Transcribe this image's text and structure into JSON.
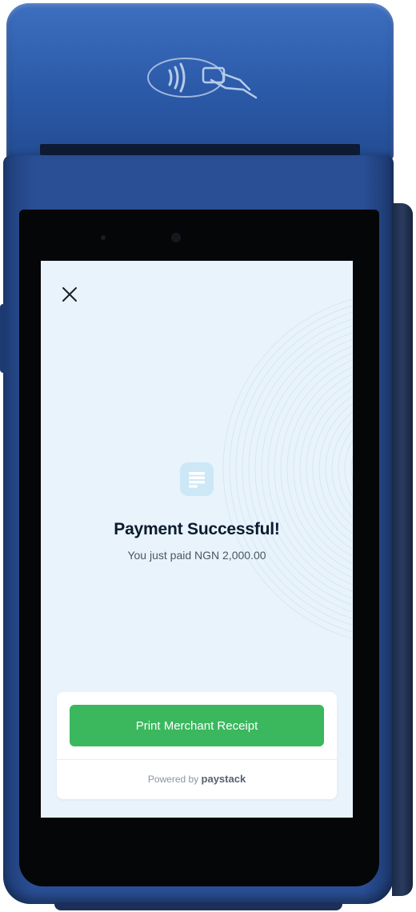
{
  "screen": {
    "close_icon": "close-icon",
    "success_icon": "receipt-icon",
    "title": "Payment Successful!",
    "subtitle": "You just paid NGN 2,000.00"
  },
  "actions": {
    "print_label": "Print Merchant Receipt"
  },
  "footer": {
    "powered_prefix": "Powered by",
    "powered_brand": "paystack"
  },
  "colors": {
    "accent_green": "#3bb75e",
    "screen_bg": "#e8f3fb",
    "device_blue": "#2a4f95",
    "title_text": "#0b1a2e"
  }
}
